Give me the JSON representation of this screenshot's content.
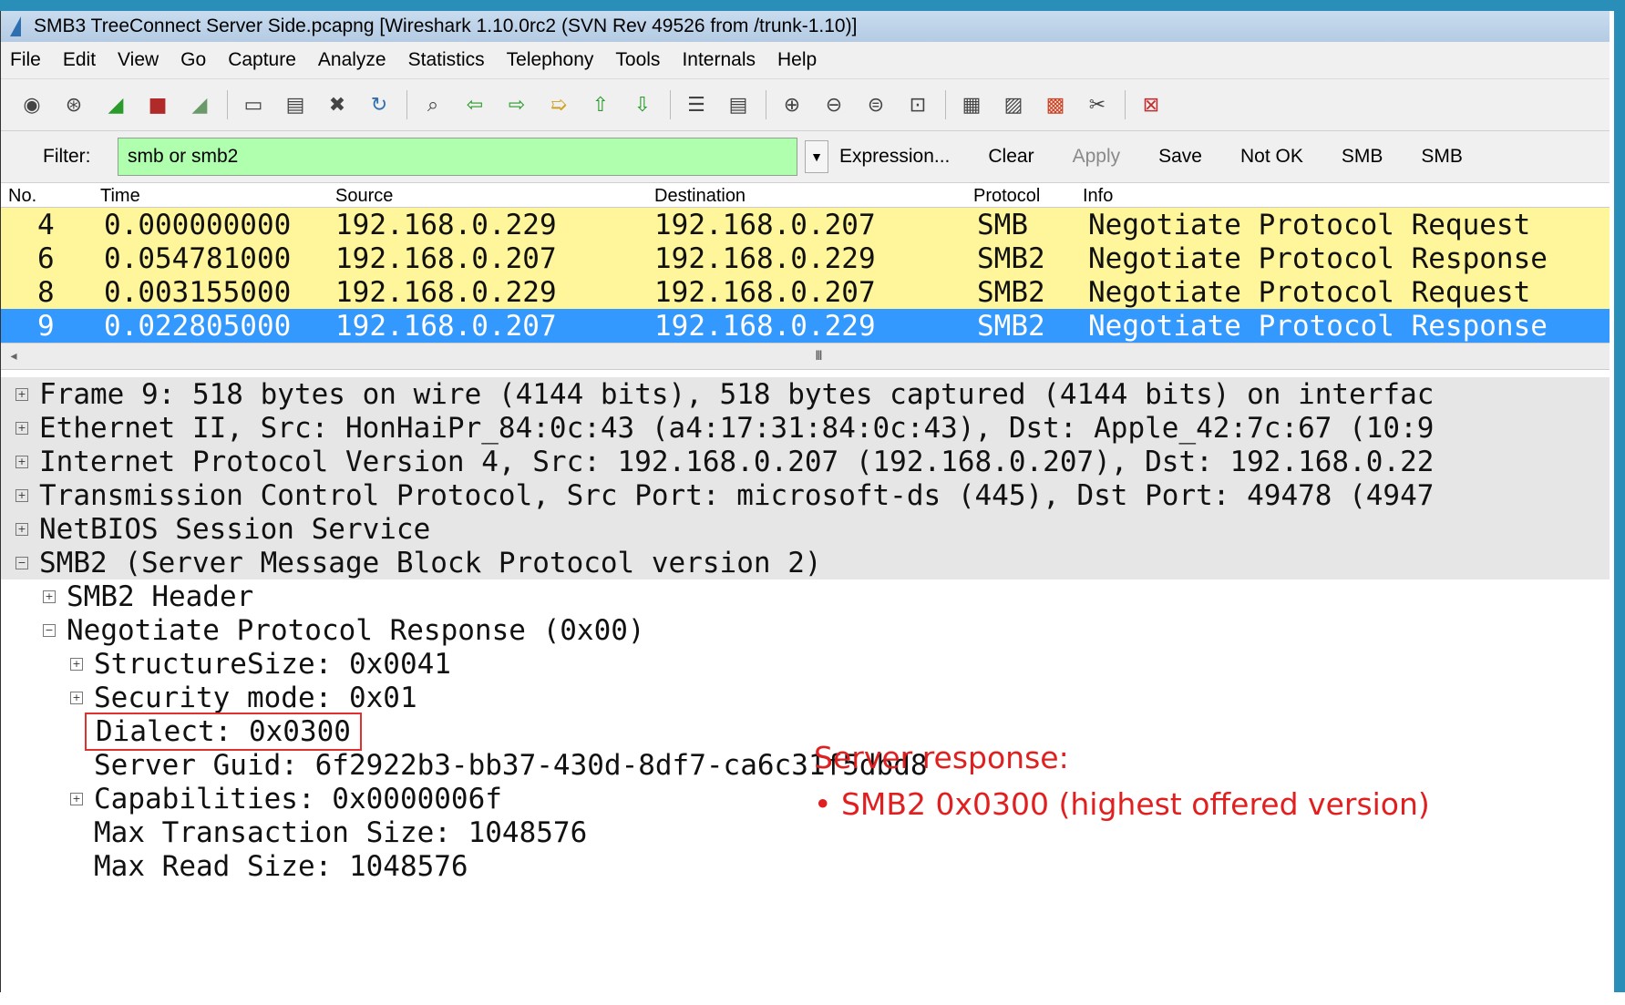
{
  "window": {
    "title": "SMB3 TreeConnect Server Side.pcapng   [Wireshark 1.10.0rc2  (SVN Rev 49526 from /trunk-1.10)]"
  },
  "menu": [
    {
      "label": "File"
    },
    {
      "label": "Edit"
    },
    {
      "label": "View"
    },
    {
      "label": "Go"
    },
    {
      "label": "Capture"
    },
    {
      "label": "Analyze"
    },
    {
      "label": "Statistics"
    },
    {
      "label": "Telephony"
    },
    {
      "label": "Tools"
    },
    {
      "label": "Internals"
    },
    {
      "label": "Help"
    }
  ],
  "filter": {
    "label": "Filter:",
    "value": "smb or smb2",
    "expression": "Expression...",
    "clear": "Clear",
    "apply": "Apply",
    "save": "Save",
    "buttons": [
      "Not OK",
      "SMB",
      "SMB"
    ]
  },
  "packet_list": {
    "headers": {
      "no": "No.",
      "time": "Time",
      "source": "Source",
      "destination": "Destination",
      "protocol": "Protocol",
      "info": "Info"
    },
    "rows": [
      {
        "no": "4",
        "time": "0.000000000",
        "source": "192.168.0.229",
        "destination": "192.168.0.207",
        "protocol": "SMB",
        "info": "Negotiate Protocol Request"
      },
      {
        "no": "6",
        "time": "0.054781000",
        "source": "192.168.0.207",
        "destination": "192.168.0.229",
        "protocol": "SMB2",
        "info": "Negotiate Protocol Response"
      },
      {
        "no": "8",
        "time": "0.003155000",
        "source": "192.168.0.229",
        "destination": "192.168.0.207",
        "protocol": "SMB2",
        "info": "Negotiate Protocol Request"
      },
      {
        "no": "9",
        "time": "0.022805000",
        "source": "192.168.0.207",
        "destination": "192.168.0.229",
        "protocol": "SMB2",
        "info": "Negotiate Protocol Response"
      }
    ],
    "selected_row": 3,
    "scroll_thumb": "III"
  },
  "detail": {
    "frame": "Frame 9: 518 bytes on wire (4144 bits), 518 bytes captured (4144 bits) on interfac",
    "ethernet": "Ethernet II, Src: HonHaiPr_84:0c:43 (a4:17:31:84:0c:43), Dst: Apple_42:7c:67 (10:9",
    "ip": "Internet Protocol Version 4, Src: 192.168.0.207 (192.168.0.207), Dst: 192.168.0.22",
    "tcp": "Transmission Control Protocol, Src Port: microsoft-ds (445), Dst Port: 49478 (4947",
    "netbios": "NetBIOS Session Service",
    "smb2": "SMB2 (Server Message Block Protocol version 2)",
    "smb2_header": "SMB2 Header",
    "negotiate": "Negotiate Protocol Response (0x00)",
    "structure_size": "StructureSize: 0x0041",
    "security_mode": "Security mode: 0x01",
    "dialect": "Dialect: 0x0300",
    "server_guid": "Server Guid: 6f2922b3-bb37-430d-8df7-ca6c31f5dbd8",
    "capabilities": "Capabilities: 0x0000006f",
    "max_transaction": "Max Transaction Size: 1048576",
    "max_read": "Max Read Size: 1048576"
  },
  "annotation": {
    "title": "Server response:",
    "bullet": "• SMB2 0x0300  (highest offered version)"
  },
  "colors": {
    "row_highlight": "#fff59a",
    "row_selected": "#3399ff",
    "filter_ok": "#afffaf",
    "annotation": "#e02020"
  }
}
